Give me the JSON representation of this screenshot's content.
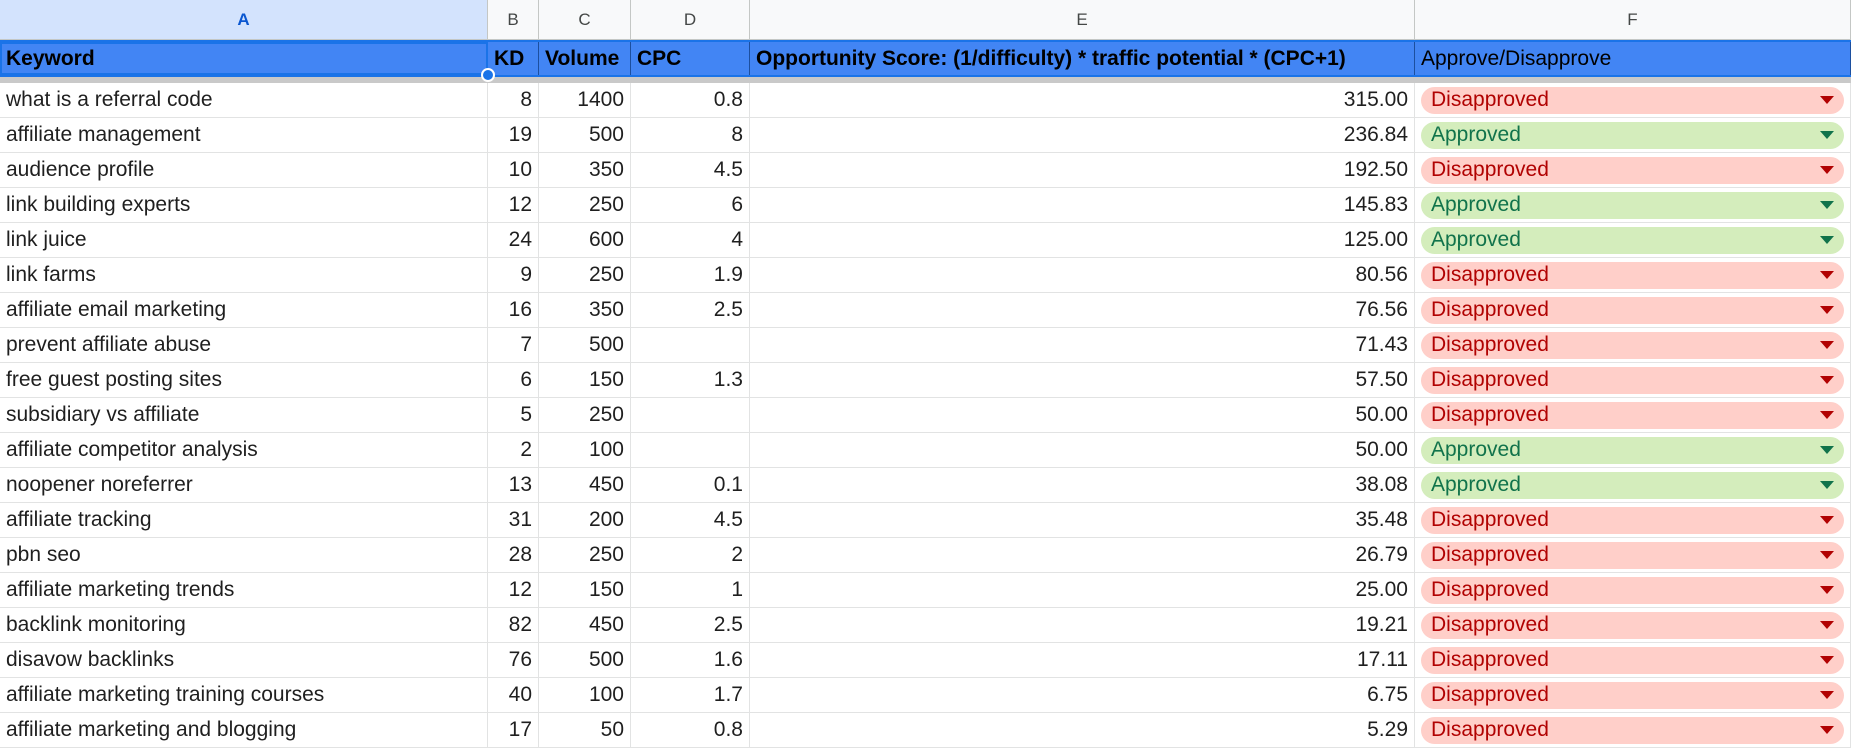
{
  "columns": [
    "A",
    "B",
    "C",
    "D",
    "E",
    "F"
  ],
  "header": {
    "keyword": "Keyword",
    "kd": "KD",
    "volume": "Volume",
    "cpc": "CPC",
    "score": "Opportunity Score: (1/difficulty) * traffic potential * (CPC+1)",
    "approve": "Approve/Disapprove"
  },
  "colors": {
    "header_bg": "#4285f4",
    "approved_bg": "#d4edbc",
    "approved_text": "#11734b",
    "disapproved_bg": "#ffcfc9",
    "disapproved_text": "#b10202"
  },
  "rows": [
    {
      "keyword": "what is a referral code",
      "kd": "8",
      "volume": "1400",
      "cpc": "0.8",
      "score": "315.00",
      "status": "Disapproved"
    },
    {
      "keyword": "affiliate management",
      "kd": "19",
      "volume": "500",
      "cpc": "8",
      "score": "236.84",
      "status": "Approved"
    },
    {
      "keyword": "audience profile",
      "kd": "10",
      "volume": "350",
      "cpc": "4.5",
      "score": "192.50",
      "status": "Disapproved"
    },
    {
      "keyword": "link building experts",
      "kd": "12",
      "volume": "250",
      "cpc": "6",
      "score": "145.83",
      "status": "Approved"
    },
    {
      "keyword": "link juice",
      "kd": "24",
      "volume": "600",
      "cpc": "4",
      "score": "125.00",
      "status": "Approved"
    },
    {
      "keyword": "link farms",
      "kd": "9",
      "volume": "250",
      "cpc": "1.9",
      "score": "80.56",
      "status": "Disapproved"
    },
    {
      "keyword": "affiliate email marketing",
      "kd": "16",
      "volume": "350",
      "cpc": "2.5",
      "score": "76.56",
      "status": "Disapproved"
    },
    {
      "keyword": "prevent affiliate abuse",
      "kd": "7",
      "volume": "500",
      "cpc": "",
      "score": "71.43",
      "status": "Disapproved"
    },
    {
      "keyword": "free guest posting sites",
      "kd": "6",
      "volume": "150",
      "cpc": "1.3",
      "score": "57.50",
      "status": "Disapproved"
    },
    {
      "keyword": "subsidiary vs affiliate",
      "kd": "5",
      "volume": "250",
      "cpc": "",
      "score": "50.00",
      "status": "Disapproved"
    },
    {
      "keyword": "affiliate competitor analysis",
      "kd": "2",
      "volume": "100",
      "cpc": "",
      "score": "50.00",
      "status": "Approved"
    },
    {
      "keyword": "noopener noreferrer",
      "kd": "13",
      "volume": "450",
      "cpc": "0.1",
      "score": "38.08",
      "status": "Approved"
    },
    {
      "keyword": "affiliate tracking",
      "kd": "31",
      "volume": "200",
      "cpc": "4.5",
      "score": "35.48",
      "status": "Disapproved"
    },
    {
      "keyword": "pbn seo",
      "kd": "28",
      "volume": "250",
      "cpc": "2",
      "score": "26.79",
      "status": "Disapproved"
    },
    {
      "keyword": "affiliate marketing trends",
      "kd": "12",
      "volume": "150",
      "cpc": "1",
      "score": "25.00",
      "status": "Disapproved"
    },
    {
      "keyword": "backlink monitoring",
      "kd": "82",
      "volume": "450",
      "cpc": "2.5",
      "score": "19.21",
      "status": "Disapproved"
    },
    {
      "keyword": "disavow backlinks",
      "kd": "76",
      "volume": "500",
      "cpc": "1.6",
      "score": "17.11",
      "status": "Disapproved"
    },
    {
      "keyword": "affiliate marketing training courses",
      "kd": "40",
      "volume": "100",
      "cpc": "1.7",
      "score": "6.75",
      "status": "Disapproved"
    },
    {
      "keyword": "affiliate marketing and blogging",
      "kd": "17",
      "volume": "50",
      "cpc": "0.8",
      "score": "5.29",
      "status": "Disapproved"
    }
  ]
}
